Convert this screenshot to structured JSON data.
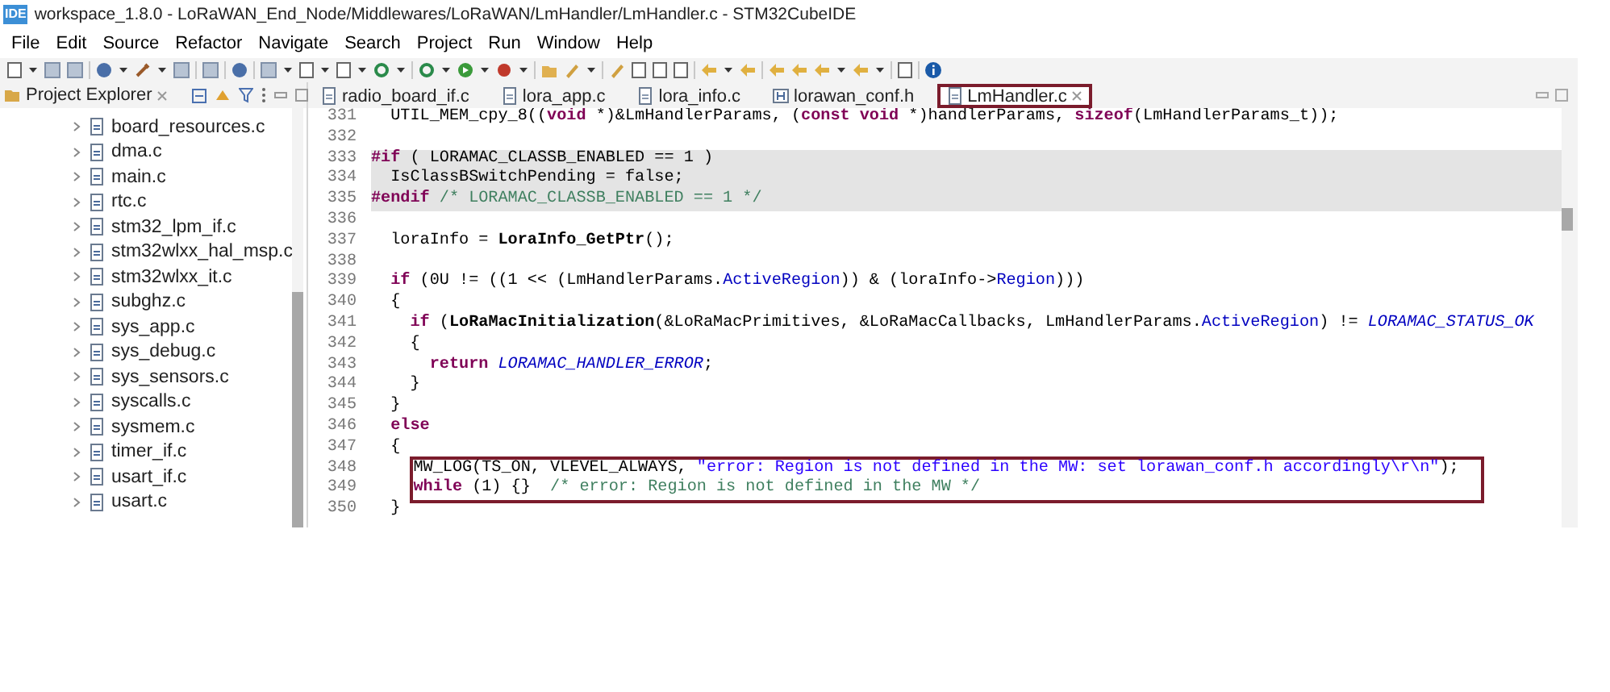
{
  "window": {
    "app_icon": "IDE",
    "title": "workspace_1.8.0 - LoRaWAN_End_Node/Middlewares/LoRaWAN/LmHandler/LmHandler.c - STM32CubeIDE"
  },
  "menu": [
    "File",
    "Edit",
    "Source",
    "Refactor",
    "Navigate",
    "Search",
    "Project",
    "Run",
    "Window",
    "Help"
  ],
  "project_explorer": {
    "title": "Project Explorer",
    "items": [
      {
        "label": "board_resources.c",
        "expanded": false
      },
      {
        "label": "dma.c",
        "expanded": false
      },
      {
        "label": "main.c",
        "expanded": false
      },
      {
        "label": "rtc.c",
        "expanded": false
      },
      {
        "label": "stm32_lpm_if.c",
        "expanded": false
      },
      {
        "label": "stm32wlxx_hal_msp.c",
        "expanded": false
      },
      {
        "label": "stm32wlxx_it.c",
        "expanded": false
      },
      {
        "label": "subghz.c",
        "expanded": false
      },
      {
        "label": "sys_app.c",
        "expanded": false
      },
      {
        "label": "sys_debug.c",
        "expanded": false
      },
      {
        "label": "sys_sensors.c",
        "expanded": false
      },
      {
        "label": "syscalls.c",
        "expanded": false
      },
      {
        "label": "sysmem.c",
        "expanded": false
      },
      {
        "label": "timer_if.c",
        "expanded": false
      },
      {
        "label": "usart_if.c",
        "expanded": false
      },
      {
        "label": "usart.c",
        "expanded": false
      }
    ]
  },
  "editor_tabs": [
    {
      "label": "radio_board_if.c",
      "kind": "source",
      "selected": false,
      "annotated": false
    },
    {
      "label": "lora_app.c",
      "kind": "source",
      "selected": false,
      "annotated": false
    },
    {
      "label": "lora_info.c",
      "kind": "source",
      "selected": false,
      "annotated": false
    },
    {
      "label": "lorawan_conf.h",
      "kind": "header",
      "selected": false,
      "annotated": false
    },
    {
      "label": "LmHandler.c",
      "kind": "source",
      "selected": true,
      "annotated": true
    }
  ],
  "code_lines": [
    {
      "number": "331",
      "highlighted": false,
      "annotated": false,
      "segments": [
        {
          "kind": "plain",
          "text": "  UTIL_MEM_cpy_8(("
        },
        {
          "kind": "keyword",
          "text": "void"
        },
        {
          "kind": "plain",
          "text": " *)&LmHandlerParams, ("
        },
        {
          "kind": "keyword",
          "text": "const void"
        },
        {
          "kind": "plain",
          "text": " *)handlerParams, "
        },
        {
          "kind": "keyword",
          "text": "sizeof"
        },
        {
          "kind": "plain",
          "text": "(LmHandlerParams_t));"
        }
      ]
    },
    {
      "number": "332",
      "highlighted": false,
      "annotated": false
    },
    {
      "number": "333",
      "highlighted": true,
      "annotated": false,
      "segments": [
        {
          "kind": "keyword",
          "text": "#if"
        },
        {
          "kind": "plain",
          "text": " ( LORAMAC_CLASSB_ENABLED == 1 )"
        }
      ]
    },
    {
      "number": "334",
      "highlighted": true,
      "annotated": false,
      "segments": [
        {
          "kind": "plain",
          "text": "  IsClassBSwitchPending = false;"
        }
      ]
    },
    {
      "number": "335",
      "highlighted": true,
      "annotated": false,
      "segments": [
        {
          "kind": "keyword",
          "text": "#endif"
        },
        {
          "kind": "comment",
          "text": " /* LORAMAC_CLASSB_ENABLED == 1 */"
        }
      ]
    },
    {
      "number": "336",
      "highlighted": false,
      "annotated": false
    },
    {
      "number": "337",
      "highlighted": false,
      "annotated": false,
      "segments": [
        {
          "kind": "plain",
          "text": "  loraInfo = "
        },
        {
          "kind": "function",
          "text": "LoraInfo_GetPtr"
        },
        {
          "kind": "plain",
          "text": "();"
        }
      ]
    },
    {
      "number": "338",
      "highlighted": false,
      "annotated": false
    },
    {
      "number": "339",
      "highlighted": false,
      "annotated": false,
      "segments": [
        {
          "kind": "keyword",
          "text": "  if"
        },
        {
          "kind": "plain",
          "text": " (0U != ((1 << (LmHandlerParams."
        },
        {
          "kind": "field",
          "text": "ActiveRegion"
        },
        {
          "kind": "plain",
          "text": ")) & (loraInfo->"
        },
        {
          "kind": "field",
          "text": "Region"
        },
        {
          "kind": "plain",
          "text": ")))"
        }
      ]
    },
    {
      "number": "340",
      "highlighted": false,
      "annotated": false,
      "segments": [
        {
          "kind": "plain",
          "text": "  {"
        }
      ]
    },
    {
      "number": "341",
      "highlighted": false,
      "annotated": false,
      "segments": [
        {
          "kind": "keyword",
          "text": "    if"
        },
        {
          "kind": "plain",
          "text": " ("
        },
        {
          "kind": "function",
          "text": "LoRaMacInitialization"
        },
        {
          "kind": "plain",
          "text": "(&LoRaMacPrimitives, &LoRaMacCallbacks, LmHandlerParams."
        },
        {
          "kind": "field",
          "text": "ActiveRegion"
        },
        {
          "kind": "plain",
          "text": ") != "
        },
        {
          "kind": "macro",
          "text": "LORAMAC_STATUS_OK"
        }
      ]
    },
    {
      "number": "342",
      "highlighted": false,
      "annotated": false,
      "segments": [
        {
          "kind": "plain",
          "text": "    {"
        }
      ]
    },
    {
      "number": "343",
      "highlighted": false,
      "annotated": false,
      "segments": [
        {
          "kind": "keyword",
          "text": "      return"
        },
        {
          "kind": "macro",
          "text": " LORAMAC_HANDLER_ERROR"
        },
        {
          "kind": "plain",
          "text": ";"
        }
      ]
    },
    {
      "number": "344",
      "highlighted": false,
      "annotated": false,
      "segments": [
        {
          "kind": "plain",
          "text": "    }"
        }
      ]
    },
    {
      "number": "345",
      "highlighted": false,
      "annotated": false,
      "segments": [
        {
          "kind": "plain",
          "text": "  }"
        }
      ]
    },
    {
      "number": "346",
      "highlighted": false,
      "annotated": false,
      "segments": [
        {
          "kind": "keyword",
          "text": "  else"
        }
      ]
    },
    {
      "number": "347",
      "highlighted": false,
      "annotated": false,
      "segments": [
        {
          "kind": "plain",
          "text": "  {"
        }
      ]
    },
    {
      "number": "348",
      "highlighted": false,
      "annotated": true,
      "segments": [
        {
          "kind": "plain",
          "text": "    MW_LOG(TS_ON, VLEVEL_ALWAYS, "
        },
        {
          "kind": "string",
          "text": "\"error: Region is not defined in the MW: set lorawan_conf.h accordingly\\r\\n\""
        },
        {
          "kind": "plain",
          "text": ");"
        }
      ]
    },
    {
      "number": "349",
      "highlighted": false,
      "annotated": true,
      "segments": [
        {
          "kind": "keyword",
          "text": "    while"
        },
        {
          "kind": "plain",
          "text": " (1) {}  "
        },
        {
          "kind": "comment",
          "text": "/* error: Region is not defined in the MW */"
        }
      ]
    },
    {
      "number": "350",
      "highlighted": false,
      "annotated": false,
      "segments": [
        {
          "kind": "plain",
          "text": "  }"
        }
      ]
    }
  ]
}
